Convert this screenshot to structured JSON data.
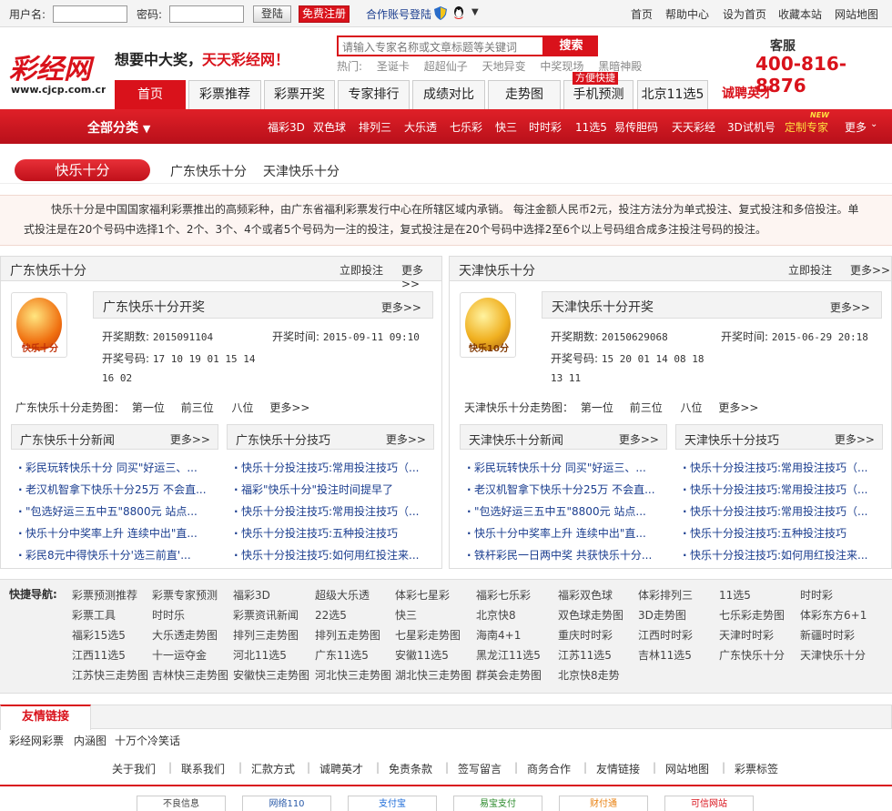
{
  "topbar": {
    "username_label": "用户名:",
    "password_label": "密码:",
    "login_label": "登陆",
    "register_label": "免费注册",
    "partner_login": "合作账号登陆",
    "links": [
      "首页",
      "帮助中心",
      "设为首页",
      "收藏本站",
      "网站地图"
    ]
  },
  "header": {
    "logo_text": "彩经网",
    "logo_url": "www.cjcp.com.cn",
    "slogan_a": "想要中大奖，",
    "slogan_b": "天天彩经网！",
    "search_placeholder": "请输入专家名称或文章标题等关键词",
    "search_button": "搜索",
    "hot_label": "热门:",
    "hot_items": [
      "圣诞卡",
      "超超仙子",
      "天地异变",
      "中奖现场",
      "黑暗神殿"
    ],
    "service_label": "客服",
    "service_tel": "400-816-8876"
  },
  "nav": {
    "tabs": [
      "首页",
      "彩票推荐",
      "彩票开奖",
      "专家排行",
      "成绩对比",
      "走势图",
      "手机预测",
      "北京11选5",
      "诚聘英才"
    ],
    "badge": "方便快捷",
    "all_category": "全部分类",
    "red_links": [
      "福彩3D",
      "双色球",
      "排列三",
      "大乐透",
      "七乐彩",
      "快三",
      "时时彩",
      "11选5",
      "易传胆码",
      "天天彩经",
      "3D试机号",
      "定制专家",
      "更多"
    ],
    "new_label": "NEW"
  },
  "section": {
    "title": "快乐十分",
    "subs": [
      "广东快乐十分",
      "天津快乐十分"
    ],
    "intro": "快乐十分是中国国家福利彩票推出的高频彩种，由广东省福利彩票发行中心在所辖区域内承销。 每注金额人民币2元，投注方法分为单式投注、复式投注和多倍投注。单式投注是在20个号码中选择1个、2个、3个、4个或者5个号码为一注的投注，复式投注是在20个号码中选择2至6个以上号码组合成多注投注号码的投注。"
  },
  "panels": [
    {
      "title": "广东快乐十分",
      "bet": "立即投注",
      "more": "更多>>",
      "logo_text": "快乐十分",
      "draw_title": "广东快乐十分开奖",
      "issue_label": "开奖期数:",
      "issue": "2015091104",
      "time_label": "开奖时间:",
      "time": "2015-09-11 09:10",
      "nums_label": "开奖号码:",
      "nums_line1": "17 10 19 01 15 14",
      "nums_line2": "16 02",
      "trend_label": "广东快乐十分走势图：",
      "trend_items": [
        "第一位",
        "前三位",
        "八位",
        "更多>>"
      ],
      "news_title": "广东快乐十分新闻",
      "tips_title": "广东快乐十分技巧",
      "news": [
        "彩民玩转快乐十分 同买\"好运三、...",
        "老汉机智拿下快乐十分25万 不会直...",
        "\"包选好运三五中五\"8800元 站点...",
        "快乐十分中奖率上升 连续中出\"直...",
        "彩民8元中得快乐十分'选三前直'..."
      ],
      "tips": [
        "快乐十分投注技巧:常用投注技巧（...",
        "福彩\"快乐十分\"投注时间提早了",
        "快乐十分投注技巧:常用投注技巧（...",
        "快乐十分投注技巧:五种投注技巧",
        "快乐十分投注技巧:如何用红投注来..."
      ]
    },
    {
      "title": "天津快乐十分",
      "bet": "立即投注",
      "more": "更多>>",
      "logo_text": "快乐10分",
      "draw_title": "天津快乐十分开奖",
      "issue_label": "开奖期数:",
      "issue": "20150629068",
      "time_label": "开奖时间:",
      "time": "2015-06-29 20:18",
      "nums_label": "开奖号码:",
      "nums_line1": "15 20 01 14 08 18",
      "nums_line2": "13 11",
      "trend_label": "天津快乐十分走势图：",
      "trend_items": [
        "第一位",
        "前三位",
        "八位",
        "更多>>"
      ],
      "news_title": "天津快乐十分新闻",
      "tips_title": "天津快乐十分技巧",
      "news": [
        "彩民玩转快乐十分 同买\"好运三、...",
        "老汉机智拿下快乐十分25万 不会直...",
        "\"包选好运三五中五\"8800元 站点...",
        "快乐十分中奖率上升 连续中出\"直...",
        "铁杆彩民一日两中奖 共获快乐十分..."
      ],
      "tips": [
        "快乐十分投注技巧:常用投注技巧（...",
        "快乐十分投注技巧:常用投注技巧（...",
        "快乐十分投注技巧:常用投注技巧（...",
        "快乐十分投注技巧:五种投注技巧",
        "快乐十分投注技巧:如何用红投注来..."
      ]
    }
  ],
  "quicknav": {
    "label": "快捷导航:",
    "rows": [
      [
        "彩票预测推荐",
        "彩票专家预测",
        "福彩3D",
        "超级大乐透",
        "体彩七星彩",
        "福彩七乐彩",
        "福彩双色球",
        "体彩排列三",
        "11选5",
        "时时彩"
      ],
      [
        "彩票工具",
        "时时乐",
        "彩票资讯新闻",
        "22选5",
        "快三",
        "北京快8",
        "双色球走势图",
        "3D走势图",
        "七乐彩走势图",
        "体彩东方6+1"
      ],
      [
        "福彩15选5",
        "大乐透走势图",
        "排列三走势图",
        "排列五走势图",
        "七星彩走势图",
        "海南4+1",
        "重庆时时彩",
        "江西时时彩",
        "天津时时彩",
        "新疆时时彩"
      ],
      [
        "江西11选5",
        "十一运夺金",
        "河北11选5",
        "广东11选5",
        "安徽11选5",
        "黑龙江11选5",
        "江苏11选5",
        "吉林11选5",
        "广东快乐十分",
        "天津快乐十分"
      ],
      [
        "江苏快三走势图",
        "吉林快三走势图",
        "安徽快三走势图",
        "河北快三走势图",
        "湖北快三走势图",
        "群英会走势图",
        "北京快8走势"
      ]
    ]
  },
  "friends": {
    "title": "友情链接",
    "links": [
      "彩经网彩票",
      "内涵图",
      "十万个冷笑话"
    ]
  },
  "footer": {
    "links": [
      "关于我们",
      "联系我们",
      "汇款方式",
      "诚聘英才",
      "免责条款",
      "签写留言",
      "商务合作",
      "友情链接",
      "网站地图",
      "彩票标签"
    ],
    "badges": [
      "不良信息",
      "网络110",
      "支付宝",
      "易宝支付",
      "财付通",
      "可信网站"
    ]
  },
  "colors": {
    "brand_red": "#d9121b",
    "link_blue": "#1a3d8f"
  }
}
